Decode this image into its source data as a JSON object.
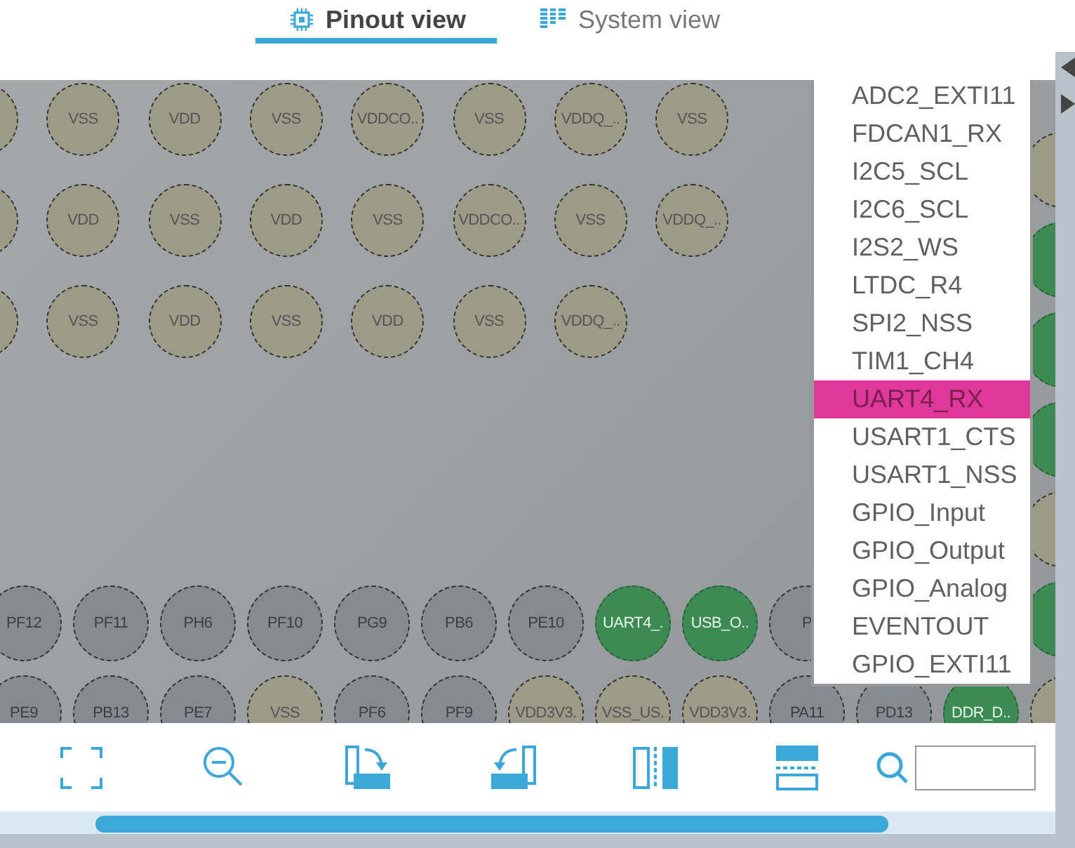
{
  "tabs": [
    {
      "label": "Pinout view",
      "kind": "chip",
      "selected": true
    },
    {
      "label": "System view",
      "kind": "bars",
      "selected": false
    }
  ],
  "pinout": {
    "upper_rows": [
      [
        {
          "kind": "power"
        },
        {
          "label": "VSS",
          "kind": "power"
        },
        {
          "label": "VDD",
          "kind": "power"
        },
        {
          "label": "VSS",
          "kind": "power"
        },
        {
          "label": "VDDCO..",
          "kind": "power"
        },
        {
          "label": "VSS",
          "kind": "power"
        },
        {
          "label": "VDDQ_..",
          "kind": "power"
        },
        {
          "label": "VSS",
          "kind": "power"
        }
      ],
      [
        {
          "kind": "power"
        },
        {
          "label": "VDD",
          "kind": "power"
        },
        {
          "label": "VSS",
          "kind": "power"
        },
        {
          "label": "VDD",
          "kind": "power"
        },
        {
          "label": "VSS",
          "kind": "power"
        },
        {
          "label": "VDDCO..",
          "kind": "power"
        },
        {
          "label": "VSS",
          "kind": "power"
        },
        {
          "label": "VDDQ_..",
          "kind": "power"
        }
      ],
      [
        {
          "kind": "power"
        },
        {
          "label": "VSS",
          "kind": "power"
        },
        {
          "label": "VDD",
          "kind": "power"
        },
        {
          "label": "VSS",
          "kind": "power"
        },
        {
          "label": "VDD",
          "kind": "power"
        },
        {
          "label": "VSS",
          "kind": "power"
        },
        {
          "label": "VDDQ_..",
          "kind": "power"
        }
      ]
    ],
    "lower_rows": [
      [
        {
          "label": "PF12",
          "kind": "gpio"
        },
        {
          "label": "PF11",
          "kind": "gpio"
        },
        {
          "label": "PH6",
          "kind": "gpio"
        },
        {
          "label": "PF10",
          "kind": "gpio"
        },
        {
          "label": "PG9",
          "kind": "gpio"
        },
        {
          "label": "PB6",
          "kind": "gpio"
        },
        {
          "label": "PE10",
          "kind": "gpio"
        },
        {
          "label": "UART4_.",
          "kind": "assigned"
        },
        {
          "label": "USB_O..",
          "kind": "assigned"
        },
        {
          "label": "P",
          "kind": "gpio"
        }
      ],
      [
        {
          "label": "PE9",
          "kind": "gpio"
        },
        {
          "label": "PB13",
          "kind": "gpio"
        },
        {
          "label": "PE7",
          "kind": "gpio"
        },
        {
          "label": "VSS",
          "kind": "power"
        },
        {
          "label": "PF6",
          "kind": "gpio"
        },
        {
          "label": "PF9",
          "kind": "gpio"
        },
        {
          "label": "VDD3V3.",
          "kind": "power"
        },
        {
          "label": "VSS_US.",
          "kind": "power"
        },
        {
          "label": "VDD3V3.",
          "kind": "power"
        },
        {
          "label": "PA11",
          "kind": "gpio"
        },
        {
          "label": "PD13",
          "kind": "gpio"
        },
        {
          "label": "DDR_D..",
          "kind": "assigned"
        },
        {
          "kind": "power"
        }
      ]
    ],
    "right_column": [
      {
        "kind": "power"
      },
      {
        "kind": "assigned"
      },
      {
        "kind": "assigned"
      },
      {
        "kind": "assigned"
      },
      {
        "kind": "power"
      },
      {
        "kind": "assigned"
      }
    ]
  },
  "signal_menu": [
    {
      "label": "ADC2_EXTI11",
      "selected": false
    },
    {
      "label": "FDCAN1_RX",
      "selected": false
    },
    {
      "label": "I2C5_SCL",
      "selected": false
    },
    {
      "label": "I2C6_SCL",
      "selected": false
    },
    {
      "label": "I2S2_WS",
      "selected": false
    },
    {
      "label": "LTDC_R4",
      "selected": false
    },
    {
      "label": "SPI2_NSS",
      "selected": false
    },
    {
      "label": "TIM1_CH4",
      "selected": false
    },
    {
      "label": "UART4_RX",
      "selected": true
    },
    {
      "label": "USART1_CTS",
      "selected": false
    },
    {
      "label": "USART1_NSS",
      "selected": false
    },
    {
      "label": "GPIO_Input",
      "selected": false
    },
    {
      "label": "GPIO_Output",
      "selected": false
    },
    {
      "label": "GPIO_Analog",
      "selected": false
    },
    {
      "label": "EVENTOUT",
      "selected": false
    },
    {
      "label": "GPIO_EXTI11",
      "selected": false
    }
  ],
  "toolbar": [
    {
      "kind": "fit"
    },
    {
      "kind": "zoom_out"
    },
    {
      "kind": "rotate_right"
    },
    {
      "kind": "rotate_left"
    },
    {
      "kind": "flip_vertical"
    },
    {
      "kind": "flip_horizontal"
    }
  ],
  "search": {
    "kind": "search"
  }
}
